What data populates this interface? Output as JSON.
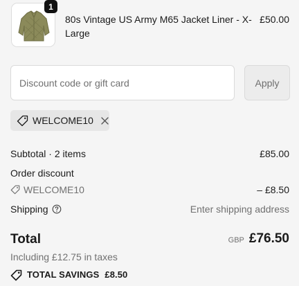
{
  "product": {
    "quantity": "1",
    "title": "80s Vintage US Army M65 Jacket Liner - X-Large",
    "price": "£50.00",
    "image_alt": "olive quilted jacket liner"
  },
  "discount": {
    "placeholder": "Discount code or gift card",
    "value": "",
    "apply_label": "Apply"
  },
  "applied_code": {
    "code": "WELCOME10"
  },
  "summary": {
    "subtotal_label": "Subtotal · 2 items",
    "subtotal_value": "£85.00",
    "order_discount_label": "Order discount",
    "order_discount_code": "WELCOME10",
    "order_discount_value": "– £8.50",
    "shipping_label": "Shipping",
    "shipping_value": "Enter shipping address",
    "total_label": "Total",
    "currency": "GBP",
    "total_value": "£76.50",
    "taxes_note": "Including £12.75 in taxes",
    "savings_label": "TOTAL SAVINGS",
    "savings_value": "£8.50"
  },
  "colors": {
    "background": "#f5f5f5",
    "text": "#1a1a1a",
    "muted": "#707070",
    "jacket": "#8b8a5a"
  }
}
